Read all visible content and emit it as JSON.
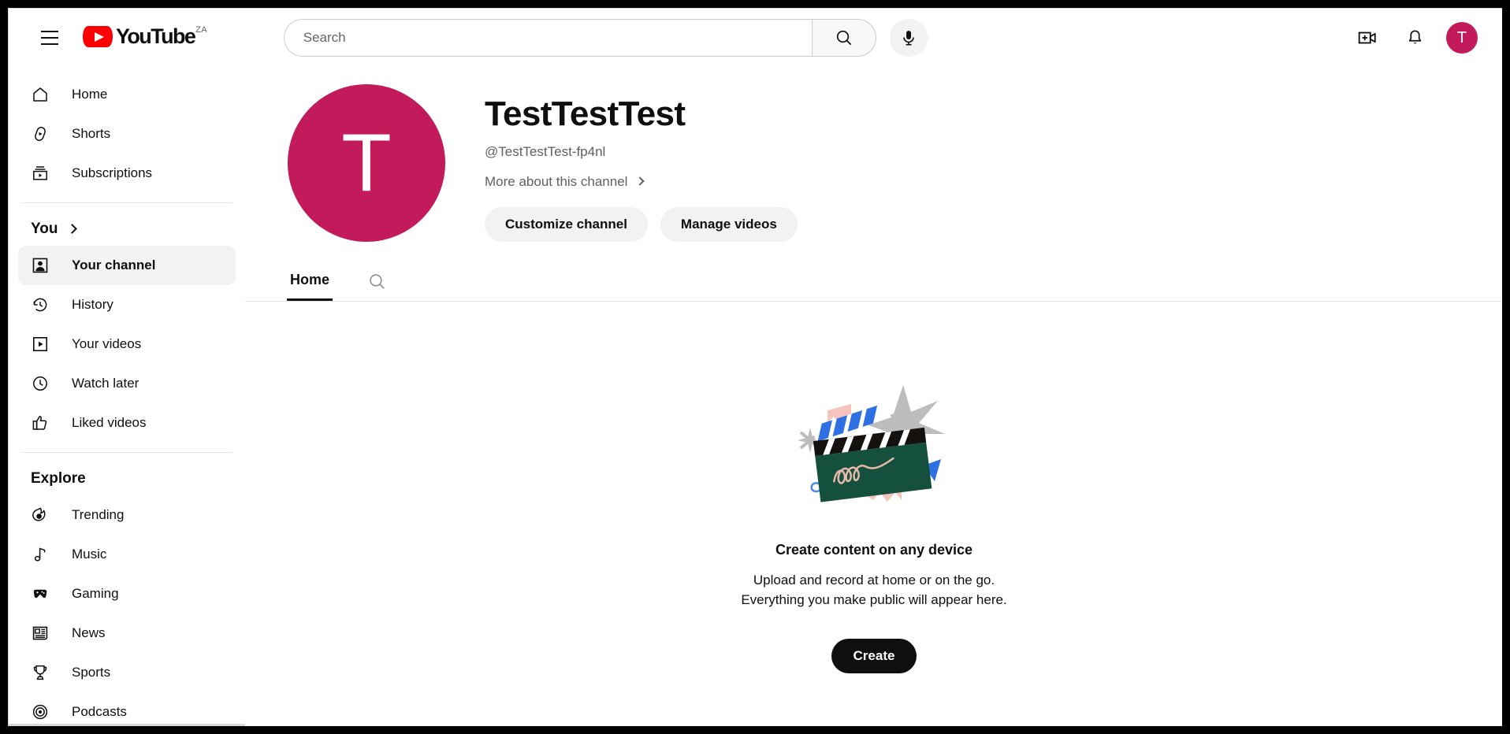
{
  "header": {
    "menu_icon": "hamburger-icon",
    "logo_text": "YouTube",
    "logo_country": "ZA",
    "search_placeholder": "Search",
    "search_value": "",
    "search_icon": "search-icon",
    "mic_icon": "microphone-icon",
    "create_icon": "create-video-icon",
    "notifications_icon": "bell-icon",
    "avatar_initial": "T"
  },
  "sidebar": {
    "primary": [
      {
        "label": "Home",
        "icon": "home-icon",
        "active": false
      },
      {
        "label": "Shorts",
        "icon": "shorts-icon",
        "active": false
      },
      {
        "label": "Subscriptions",
        "icon": "subscriptions-icon",
        "active": false
      }
    ],
    "you_header": "You",
    "you_items": [
      {
        "label": "Your channel",
        "icon": "person-icon",
        "active": true
      },
      {
        "label": "History",
        "icon": "history-icon",
        "active": false
      },
      {
        "label": "Your videos",
        "icon": "play-box-icon",
        "active": false
      },
      {
        "label": "Watch later",
        "icon": "clock-icon",
        "active": false
      },
      {
        "label": "Liked videos",
        "icon": "thumbs-up-icon",
        "active": false
      }
    ],
    "explore_header": "Explore",
    "explore_items": [
      {
        "label": "Trending",
        "icon": "trending-icon",
        "active": false
      },
      {
        "label": "Music",
        "icon": "music-note-icon",
        "active": false
      },
      {
        "label": "Gaming",
        "icon": "gamepad-icon",
        "active": false
      },
      {
        "label": "News",
        "icon": "newspaper-icon",
        "active": false
      },
      {
        "label": "Sports",
        "icon": "trophy-icon",
        "active": false
      },
      {
        "label": "Podcasts",
        "icon": "podcast-icon",
        "active": false
      }
    ]
  },
  "channel": {
    "avatar_initial": "T",
    "avatar_color": "#c21a5a",
    "name": "TestTestTest",
    "handle": "@TestTestTest-fp4nl",
    "more_link": "More about this channel",
    "customize_button": "Customize channel",
    "manage_button": "Manage videos",
    "tabs": [
      {
        "label": "Home",
        "active": true
      }
    ],
    "tab_search_icon": "search-icon"
  },
  "empty_state": {
    "illustration": "clapperboard-illustration",
    "title": "Create content on any device",
    "line1": "Upload and record at home or on the go.",
    "line2": "Everything you make public will appear here.",
    "button": "Create"
  }
}
